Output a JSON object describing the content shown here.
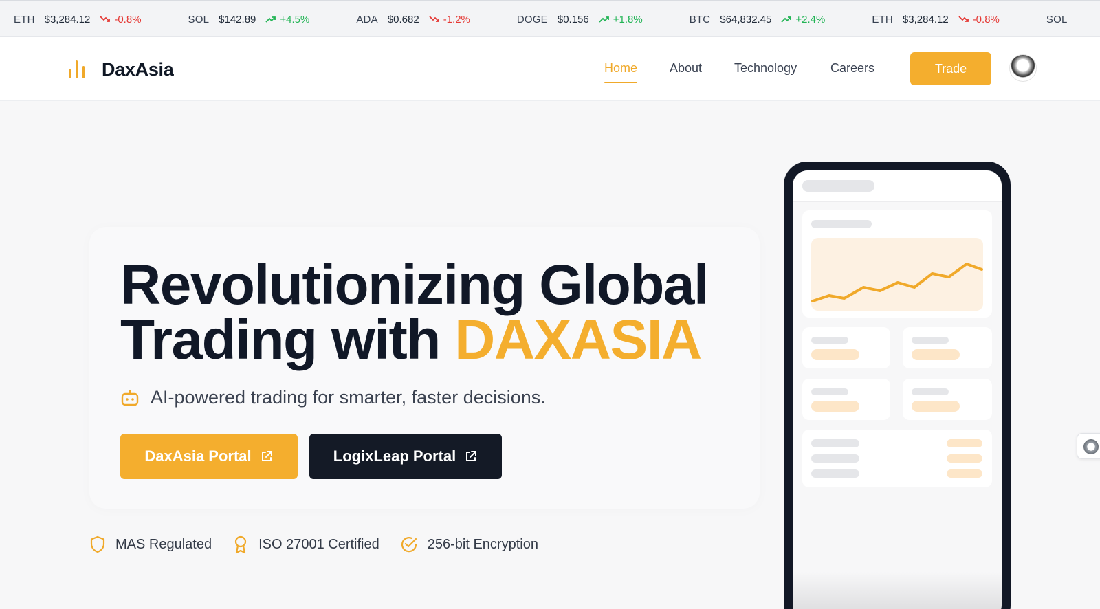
{
  "ticker": [
    {
      "symbol": "ETH",
      "price": "$3,284.12",
      "change": "-0.8%",
      "direction": "down"
    },
    {
      "symbol": "SOL",
      "price": "$142.89",
      "change": "+4.5%",
      "direction": "up"
    },
    {
      "symbol": "ADA",
      "price": "$0.682",
      "change": "-1.2%",
      "direction": "down"
    },
    {
      "symbol": "DOGE",
      "price": "$0.156",
      "change": "+1.8%",
      "direction": "up"
    },
    {
      "symbol": "BTC",
      "price": "$64,832.45",
      "change": "+2.4%",
      "direction": "up"
    },
    {
      "symbol": "ETH",
      "price": "$3,284.12",
      "change": "-0.8%",
      "direction": "down"
    },
    {
      "symbol": "SOL",
      "price": "",
      "change": "",
      "direction": "up"
    }
  ],
  "header": {
    "brand": "DaxAsia",
    "nav": [
      "Home",
      "About",
      "Technology",
      "Careers"
    ],
    "active_nav": "Home",
    "trade_label": "Trade"
  },
  "hero": {
    "headline_line1": "Revolutionizing Global",
    "headline_line2_prefix": "Trading with ",
    "headline_accent": "DAXASIA",
    "tagline": "AI-powered trading for smarter, faster decisions.",
    "primary_cta": "DaxAsia Portal",
    "secondary_cta": "LogixLeap Portal"
  },
  "badges": [
    "MAS Regulated",
    "ISO 27001 Certified",
    "256-bit Encryption"
  ],
  "icons": {
    "logo": "bar-chart-icon",
    "tagline": "robot-icon",
    "external": "external-link-icon",
    "badges": [
      "shield-icon",
      "award-icon",
      "check-circle-icon"
    ]
  },
  "colors": {
    "accent": "#f4ae2e",
    "dark": "#141a26",
    "up": "#22b455",
    "down": "#e53935"
  }
}
